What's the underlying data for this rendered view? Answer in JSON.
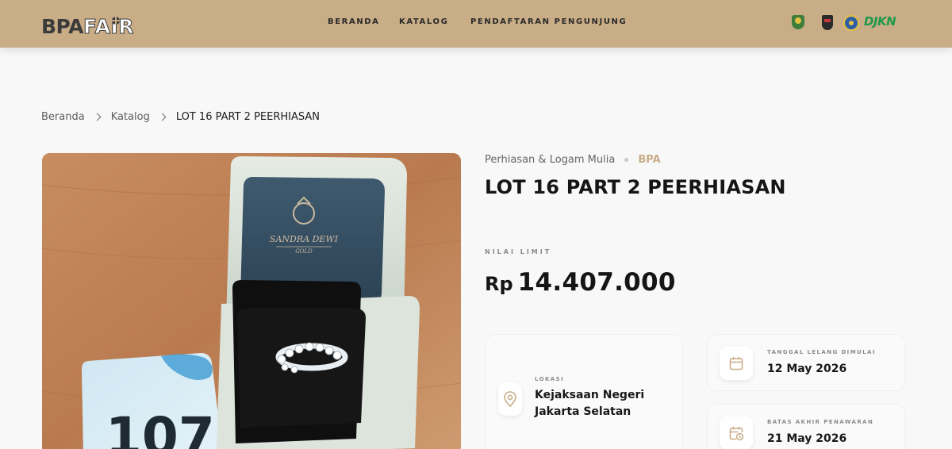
{
  "header": {
    "logo_primary": "BPA",
    "logo_secondary": "FAIR",
    "nav": [
      "BERANDA",
      "KATALOG",
      "PENDAFTARAN PENGUNJUNG"
    ],
    "partner_logos": [
      "kejaksaan-logo",
      "adhyaksa-logo",
      "kemenkeu-logo",
      "djkn-logo"
    ],
    "partner_text": "DJKN"
  },
  "breadcrumb": {
    "items": [
      "Beranda",
      "Katalog"
    ],
    "current": "LOT 16 PART 2 PEERHIASAN"
  },
  "photo": {
    "box_brand": "SANDRA DEWI",
    "box_sub": "GOLD",
    "tag_number": "107"
  },
  "product": {
    "category": "Perhiasan & Logam Mulia",
    "tag": "BPA",
    "title": "LOT 16 PART 2 PEERHIASAN",
    "limit_label": "NILAI LIMIT",
    "currency": "Rp",
    "limit_value": "14.407.000"
  },
  "details": {
    "location_label": "LOKASI",
    "location_value": "Kejaksaan Negeri Jakarta Selatan",
    "start_label": "TANGGAL LELANG DIMULAI",
    "start_value": "12 May 2026",
    "end_label": "BATAS AKHIR PENAWARAN",
    "end_value": "21 May 2026"
  },
  "colors": {
    "header_bg": "#c9ad87",
    "accent": "#c9ad87",
    "page_bg": "#f8f8f9",
    "text": "#151515",
    "partner_green": "#1d9a4a"
  }
}
